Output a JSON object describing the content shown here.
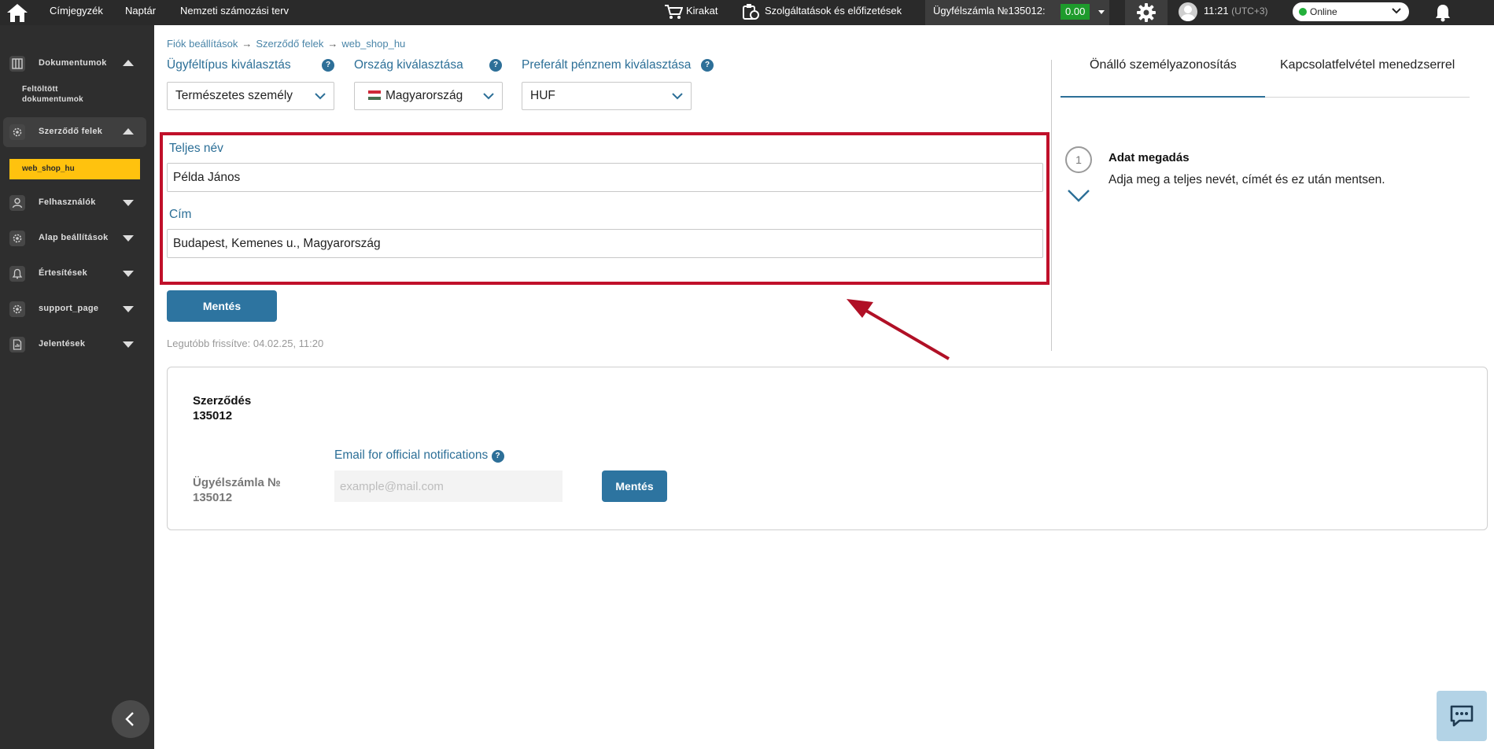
{
  "topbar": {
    "nav": [
      "Címjegyzék",
      "Naptár",
      "Nemzeti számozási terv"
    ],
    "shop_label": "Kirakat",
    "services_label": "Szolgáltatások és előfizetések",
    "account_label": "Ügyfélszámla №135012:",
    "balance": "0.00",
    "time": "11:21",
    "timezone": "(UTC+3)",
    "status": "Online",
    "colors": {
      "bar": "#2a2a2a",
      "balance_bg": "#1e9b2c",
      "online_dot": "#23b03b"
    }
  },
  "sidebar": {
    "items": [
      {
        "label": "Dokumentumok",
        "icon": "documents-icon",
        "expanded": true
      },
      {
        "label": "Szerződő felek",
        "icon": "gear-icon",
        "expanded": true,
        "active": true
      },
      {
        "label": "Felhasználók",
        "icon": "user-icon",
        "expanded": false
      },
      {
        "label": "Alap beállítások",
        "icon": "gear-icon",
        "expanded": false
      },
      {
        "label": "Értesítések",
        "icon": "bell-icon",
        "expanded": false
      },
      {
        "label": "support_page",
        "icon": "gear-icon",
        "expanded": false
      },
      {
        "label": "Jelentések",
        "icon": "report-icon",
        "expanded": false
      }
    ],
    "sub_uploaded": "Feltöltött dokumentumok",
    "current": "web_shop_hu",
    "accent": "#ffc20e"
  },
  "breadcrumb": [
    "Fiók beállítások",
    "Szerződő felek",
    "web_shop_hu"
  ],
  "filters": {
    "client_type": {
      "label": "Ügyféltípus kiválasztás",
      "value": "Természetes személy"
    },
    "country": {
      "label": "Ország kiválasztása",
      "value": "Magyarország"
    },
    "currency": {
      "label": "Preferált pénznem kiválasztása",
      "value": "HUF"
    },
    "help_glyph": "?"
  },
  "form": {
    "fullname_label": "Teljes név",
    "fullname_value": "Példa János",
    "address_label": "Cím",
    "address_value": "Budapest, Kemenes u., Magyarország",
    "save": "Mentés",
    "updated": "Legutóbb frissítve: 04.02.25, 11:20",
    "highlight_color": "#c0102a"
  },
  "right_panel": {
    "tabs": [
      "Önálló személyazonosítás",
      "Kapcsolatfelvétel menedzserrel"
    ],
    "step_number": "1",
    "step_title": "Adat megadás",
    "step_desc": "Adja meg a teljes nevét, címét és ez után mentsen."
  },
  "contract": {
    "title_line1": "Szerződés",
    "title_line2": "135012",
    "account_line1": "Ügyélszámla №",
    "account_line2": "135012",
    "email_label": "Email for official notifications",
    "email_placeholder": "example@mail.com",
    "save": "Mentés"
  }
}
